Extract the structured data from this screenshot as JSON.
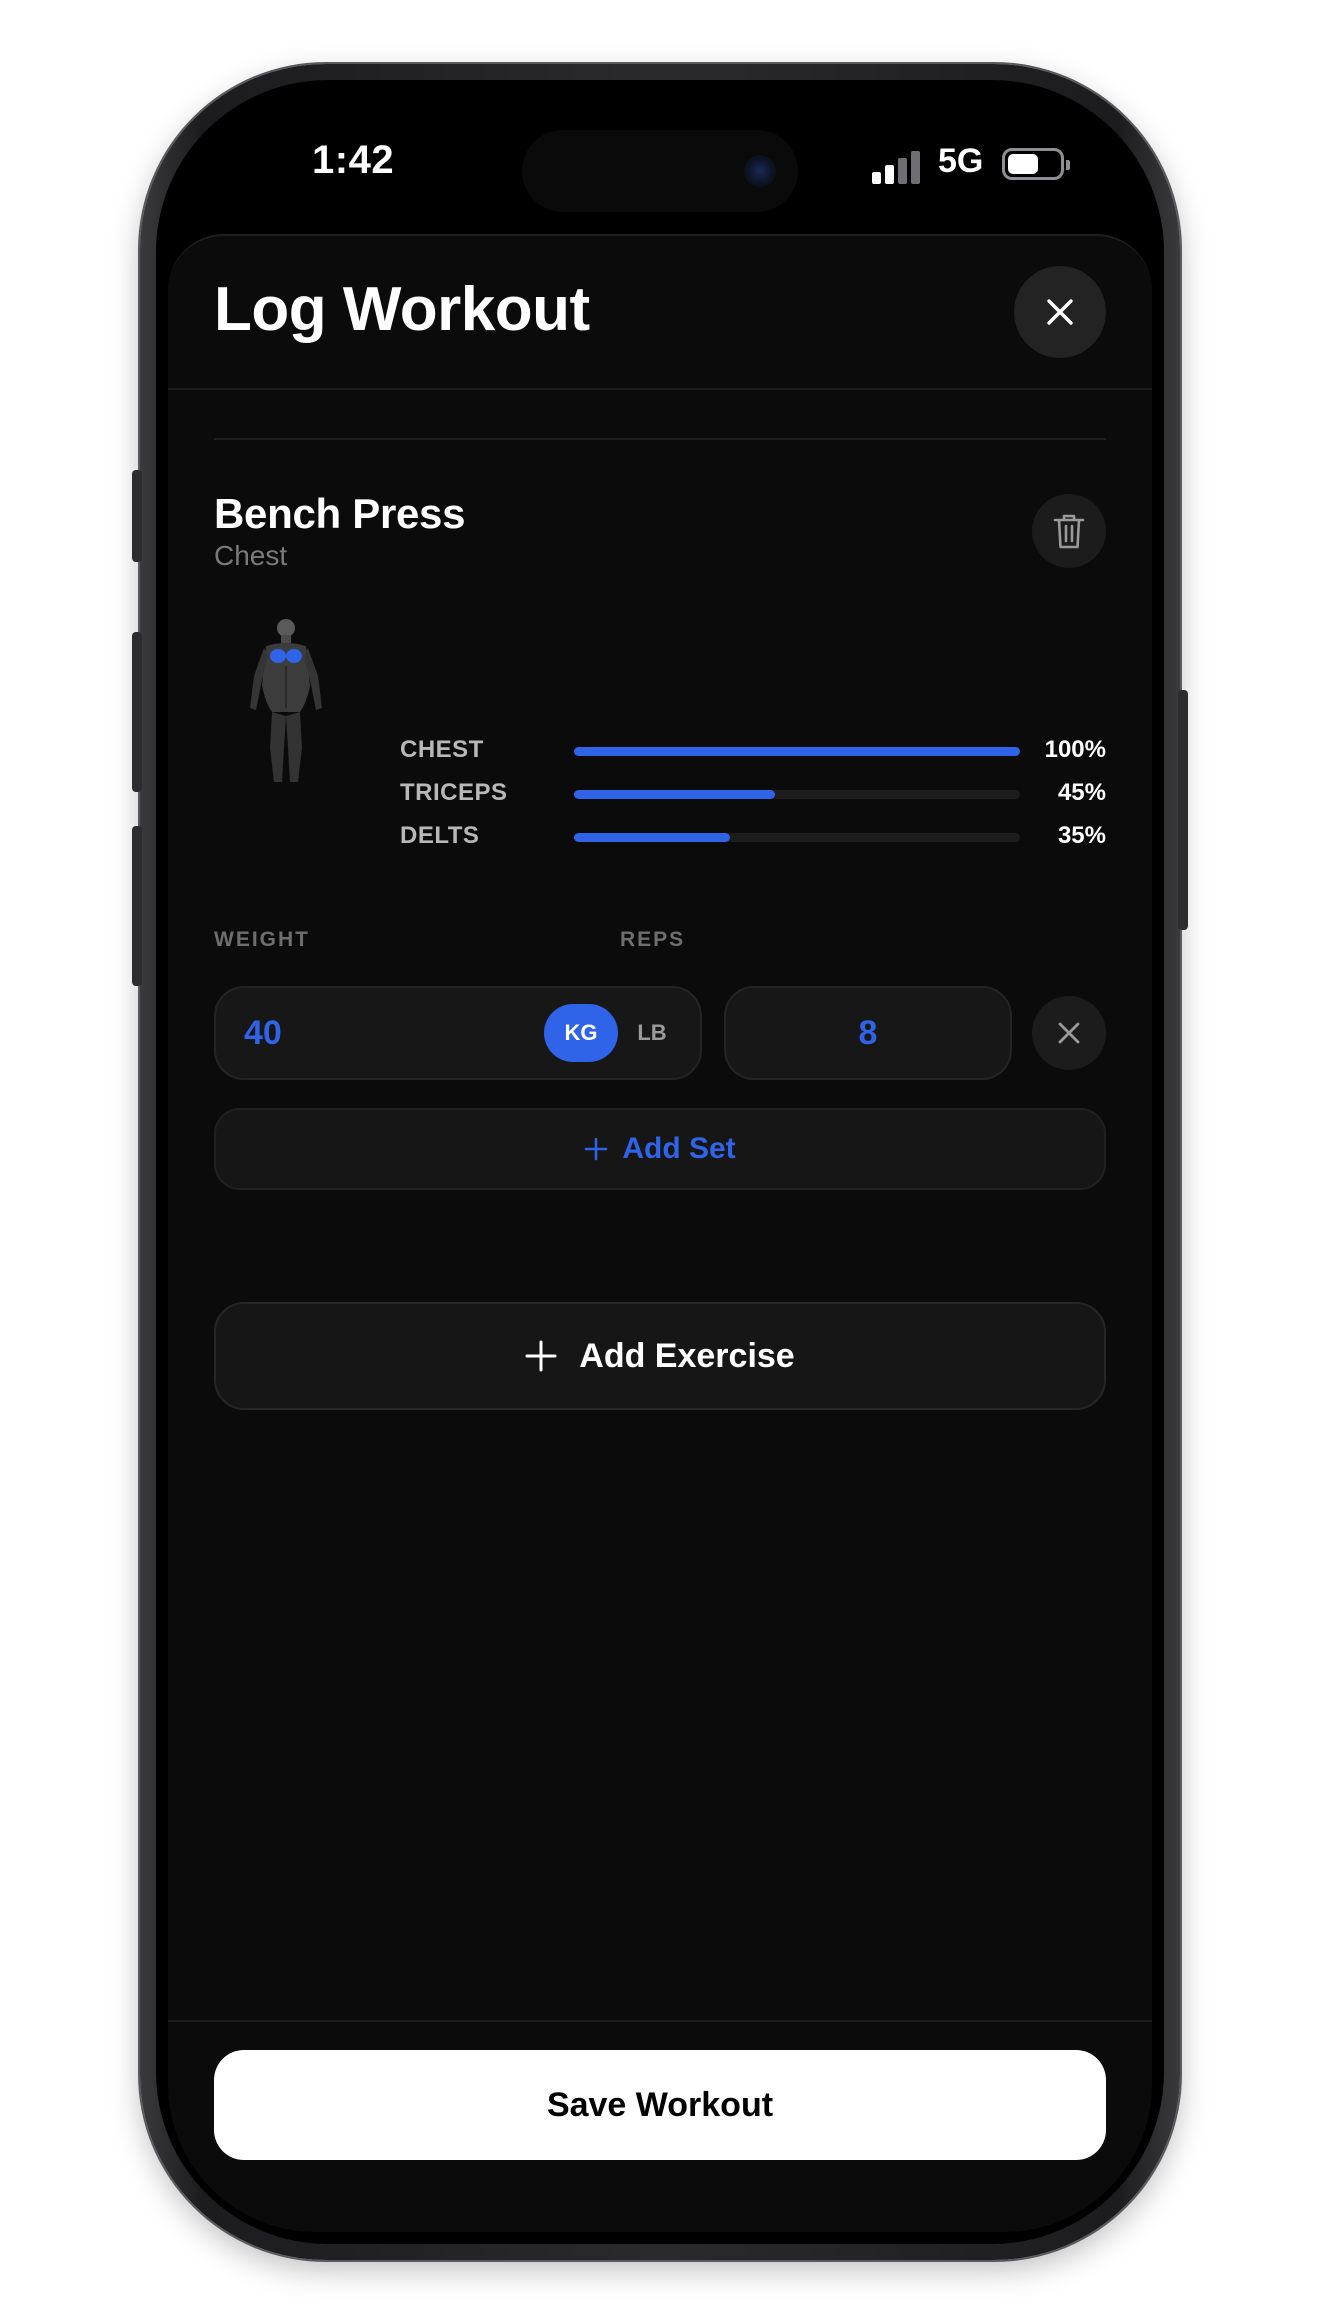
{
  "status_bar": {
    "time": "1:42",
    "network": "5G"
  },
  "header": {
    "title": "Log Workout",
    "close_icon": "close-icon"
  },
  "exercise": {
    "name": "Bench Press",
    "category": "Chest",
    "delete_icon": "trash-icon",
    "muscles": [
      {
        "label": "CHEST",
        "percent": 100,
        "percent_label": "100%"
      },
      {
        "label": "TRICEPS",
        "percent": 45,
        "percent_label": "45%"
      },
      {
        "label": "DELTS",
        "percent": 35,
        "percent_label": "35%"
      }
    ],
    "set_labels": {
      "weight": "WEIGHT",
      "reps": "REPS"
    },
    "set": {
      "weight": "40",
      "unit_kg": "KG",
      "unit_lb": "LB",
      "reps": "8",
      "selected_unit": "KG"
    },
    "add_set_label": "Add Set"
  },
  "add_exercise_label": "Add Exercise",
  "save_label": "Save Workout",
  "colors": {
    "accent": "#2f63e8",
    "background": "#0b0b0b",
    "surface": "#171717"
  }
}
